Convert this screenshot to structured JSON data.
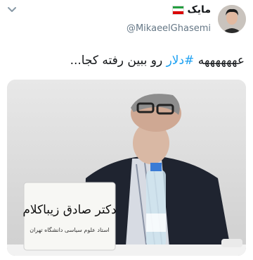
{
  "tweet": {
    "author_name": "مایک",
    "handle": "@MikaeelGhasemi",
    "text_before": "عههههههه ",
    "hashtag": "#دلار",
    "text_after": " رو ببین رفته کجا..."
  },
  "media": {
    "placard_name": "دکتر صادق زیباکلام",
    "placard_subtitle": "استاد علوم سیاسی دانشگاه تهران"
  },
  "colors": {
    "accent": "#1da1f2",
    "secondary_text": "#657786",
    "primary_text": "#14171a"
  },
  "icons": {
    "menu": "chevron-down-icon",
    "flag": "iran-flag-icon"
  }
}
